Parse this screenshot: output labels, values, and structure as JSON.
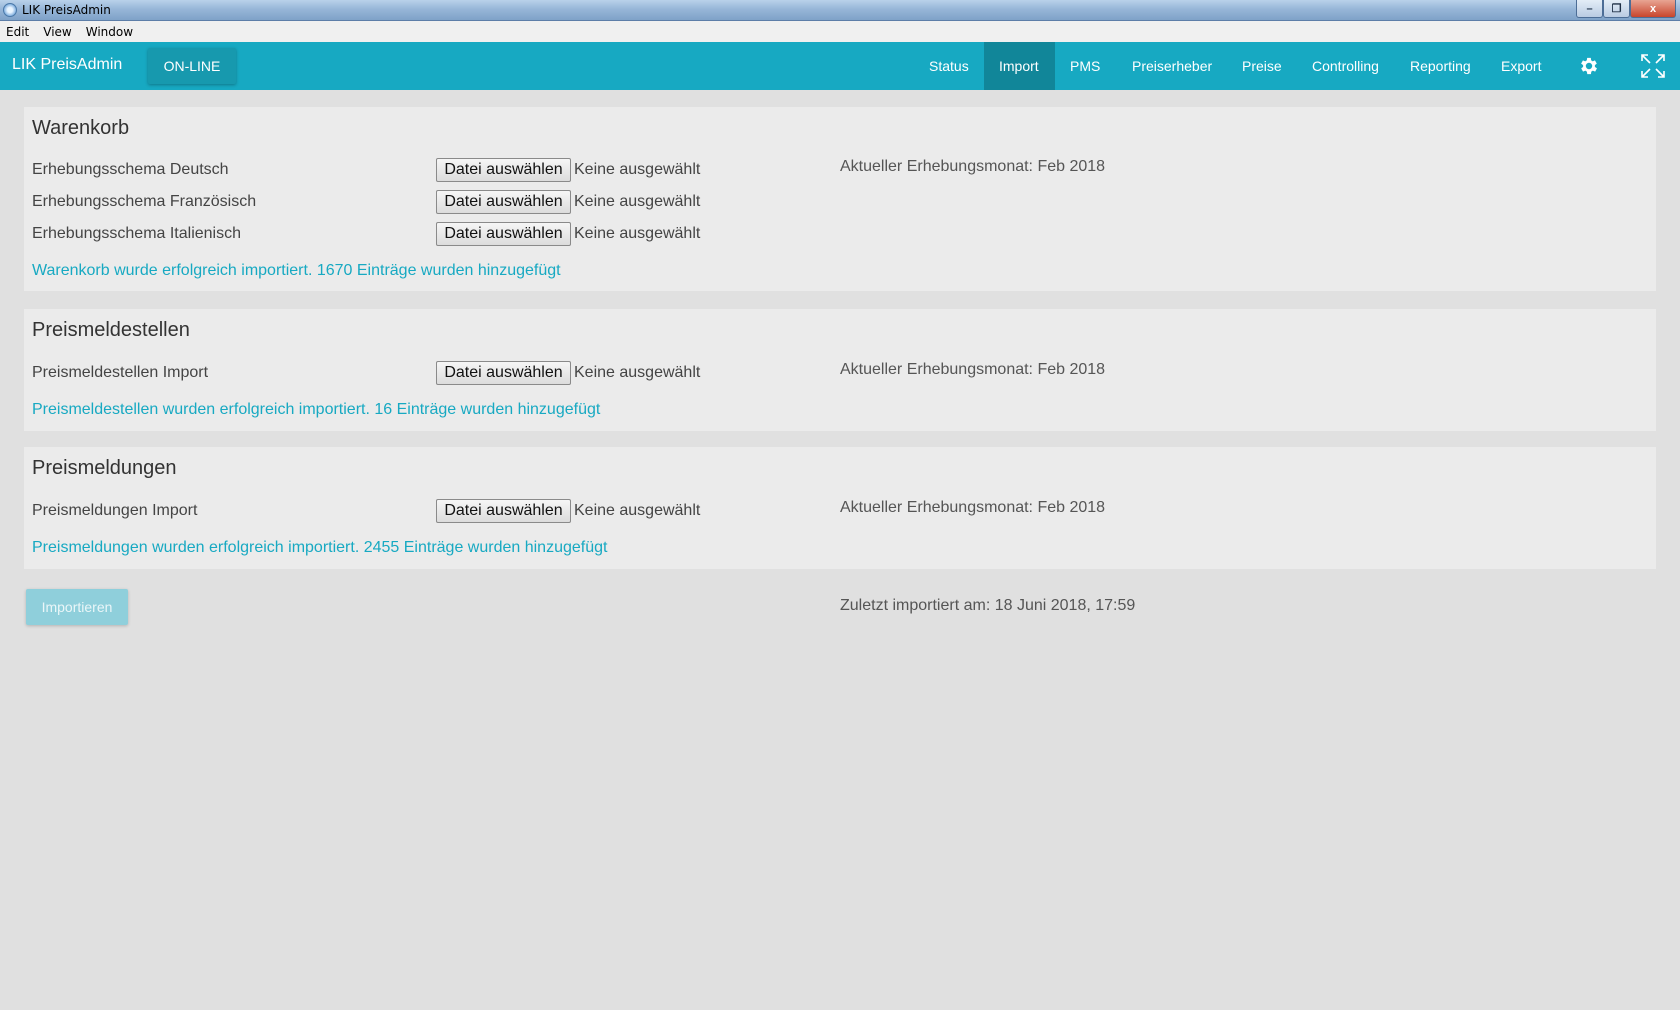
{
  "window": {
    "title": "LIK PreisAdmin",
    "minimize": "–",
    "maximize": "❐",
    "close": "x"
  },
  "menu": [
    "Edit",
    "View",
    "Window"
  ],
  "navbar": {
    "brand": "LIK PreisAdmin",
    "online_label": "ON-LINE",
    "items": [
      "Status",
      "Import",
      "PMS",
      "Preiserheber",
      "Preise",
      "Controlling",
      "Reporting",
      "Export"
    ],
    "active": "Import",
    "icons": [
      "gear-icon",
      "expand-icon"
    ]
  },
  "warenkorb": {
    "title": "Warenkorb",
    "rows": [
      {
        "label": "Erhebungsschema Deutsch",
        "button": "Datei auswählen",
        "status": "Keine ausgewählt"
      },
      {
        "label": "Erhebungsschema Französisch",
        "button": "Datei auswählen",
        "status": "Keine ausgewählt"
      },
      {
        "label": "Erhebungsschema Italienisch",
        "button": "Datei auswählen",
        "status": "Keine ausgewählt"
      }
    ],
    "month": "Aktueller Erhebungsmonat: Feb 2018",
    "success": "Warenkorb wurde erfolgreich importiert. 1670 Einträge wurden hinzugefügt"
  },
  "preismeldestellen": {
    "title": "Preismeldestellen",
    "rows": [
      {
        "label": "Preismeldestellen Import",
        "button": "Datei auswählen",
        "status": "Keine ausgewählt"
      }
    ],
    "month": "Aktueller Erhebungsmonat: Feb 2018",
    "success": "Preismeldestellen wurden erfolgreich importiert. 16 Einträge wurden hinzugefügt"
  },
  "preismeldungen": {
    "title": "Preismeldungen",
    "rows": [
      {
        "label": "Preismeldungen Import",
        "button": "Datei auswählen",
        "status": "Keine ausgewählt"
      }
    ],
    "month": "Aktueller Erhebungsmonat: Feb 2018",
    "success": "Preismeldungen wurden erfolgreich importiert. 2455 Einträge wurden hinzugefügt"
  },
  "footer": {
    "import_label": "Importieren",
    "last_import": "Zuletzt importiert am: 18 Juni 2018, 17:59"
  },
  "colors": {
    "accent": "#17a9c2",
    "accent_dark": "#118699",
    "background": "#e0e0e0",
    "panel": "#ebebeb"
  }
}
